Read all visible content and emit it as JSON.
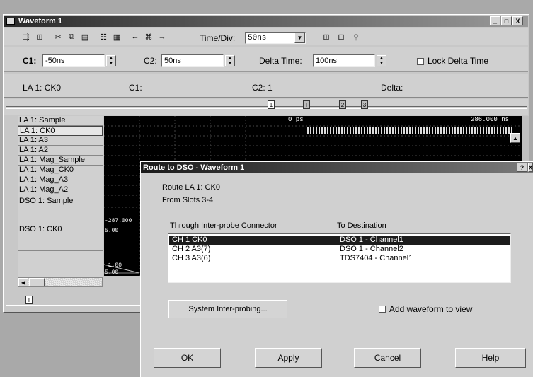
{
  "waveform_window": {
    "title": "Waveform 1",
    "title_buttons": {
      "minimize": "_",
      "maximize": "□",
      "close": "X"
    },
    "toolbar": {
      "time_div_label": "Time/Div:",
      "time_div_value": "50ns",
      "icons": [
        "new-trace-icon",
        "add-signal-icon",
        "cut-icon",
        "copy-icon",
        "paste-icon",
        "properties-icon",
        "settings-icon",
        "arrow-left-icon",
        "binoculars-icon",
        "arrow-right-icon",
        "zoom-grid-icon",
        "zoom-fit-icon",
        "zoom-icon"
      ]
    },
    "cursor_bar": {
      "c1_label": "C1:",
      "c1_value": "-50ns",
      "c2_label": "C2:",
      "c2_value": "50ns",
      "delta_time_label": "Delta Time:",
      "delta_time_value": "100ns",
      "lock_delta_label": "Lock Delta Time"
    },
    "readout_bar": {
      "signal": "LA 1: CK0",
      "c1": "C1:",
      "c2": "C2: 1",
      "delta": "Delta:"
    },
    "markers": [
      "1",
      "T",
      "2",
      "3"
    ],
    "time_start": "0 ps",
    "time_end": "286.000 ns",
    "signals": [
      "LA 1: Sample",
      "LA 1: CK0",
      "LA 1: A3",
      "LA 1: A2",
      "LA 1: Mag_Sample",
      "LA 1: Mag_CK0",
      "LA 1: Mag_A3",
      "LA 1: Mag_A2",
      "DSO 1: Sample",
      "DSO 1: CK0"
    ],
    "scale_labels": {
      "dso_sample": "-287.000",
      "dso_ck0_top": "5.00",
      "dso_ck0_mid": "-1.00",
      "dso_ck0_bot": "5.00"
    },
    "bottom_marker": "T"
  },
  "dialog": {
    "title": "Route to DSO - Waveform 1",
    "help_button": "?",
    "route_text": "Route LA 1: CK0",
    "from_text": "From Slots 3-4",
    "col_through": "Through Inter-probe Connector",
    "col_dest": "To Destination",
    "rows": [
      {
        "connector": "CH 1 CK0",
        "destination": "DSO 1 - Channel1"
      },
      {
        "connector": "CH 2 A3(7)",
        "destination": "DSO 1 - Channel2"
      },
      {
        "connector": "CH 3 A3(6)",
        "destination": "TDS7404 - Channel1"
      }
    ],
    "system_button": "System Inter-probing...",
    "add_waveform_label": "Add waveform to view",
    "buttons": {
      "ok": "OK",
      "apply": "Apply",
      "cancel": "Cancel",
      "help": "Help"
    }
  }
}
